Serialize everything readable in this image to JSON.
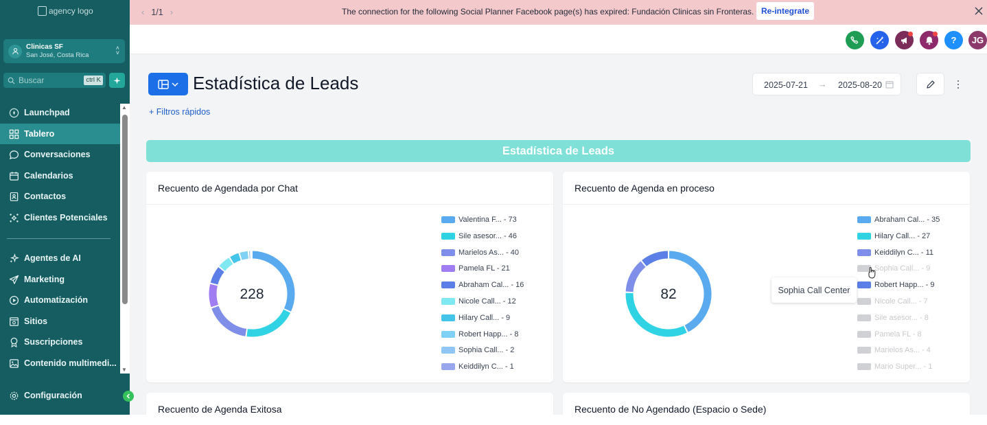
{
  "sidebar": {
    "logo_alt": "agency logo",
    "account": {
      "name": "Clinicas SF",
      "location": "San José, Costa Rica"
    },
    "search": {
      "placeholder": "Buscar",
      "shortcut": "ctrl K"
    },
    "items": [
      {
        "label": "Launchpad",
        "icon": "rocket-icon",
        "active": false
      },
      {
        "label": "Tablero",
        "icon": "grid-icon",
        "active": true
      },
      {
        "label": "Conversaciones",
        "icon": "chat-icon",
        "active": false
      },
      {
        "label": "Calendarios",
        "icon": "calendar-icon",
        "active": false
      },
      {
        "label": "Contactos",
        "icon": "contacts-icon",
        "active": false
      },
      {
        "label": "Clientes Potenciales",
        "icon": "leads-icon",
        "active": false
      },
      {
        "label": "Agentes de AI",
        "icon": "sparkle-icon",
        "active": false
      },
      {
        "label": "Marketing",
        "icon": "send-icon",
        "active": false
      },
      {
        "label": "Automatización",
        "icon": "automation-icon",
        "active": false
      },
      {
        "label": "Sitios",
        "icon": "sites-icon",
        "active": false
      },
      {
        "label": "Suscripciones",
        "icon": "badge-icon",
        "active": false
      },
      {
        "label": "Contenido multimedi...",
        "icon": "image-icon",
        "active": false
      }
    ],
    "settings_label": "Configuración"
  },
  "banner": {
    "pager": "1/1",
    "message": "The connection for the following Social Planner Facebook page(s) has expired: Fundación Clinicas sin Fronteras.",
    "action": "Re-integrate"
  },
  "header": {
    "icons": [
      "phone-icon",
      "magic-icon",
      "megaphone-icon",
      "bell-icon",
      "help-icon"
    ],
    "avatar_initials": "JG",
    "colors": {
      "phone": "#1f9d55",
      "magic": "#2563eb",
      "megaphone": "#7c2d5a",
      "bell": "#8e2a6b",
      "help": "#1e90ff",
      "avatar": "#8b3a6b"
    }
  },
  "main": {
    "title": "Estadística de Leads",
    "quick_filters": "Filtros rápidos",
    "date_from": "2025-07-21",
    "date_to": "2025-08-20",
    "section_title": "Estadística de Leads",
    "tooltip": "Sophia Call Center",
    "cards": [
      {
        "title": "Recuento de Agendada por Chat"
      },
      {
        "title": "Recuento de Agenda en proceso"
      },
      {
        "title": "Recuento de Agenda Exitosa"
      },
      {
        "title": "Recuento de No Agendado (Espacio o Sede)"
      }
    ]
  },
  "chart_data": [
    {
      "type": "pie",
      "title": "Recuento de Agendada por Chat",
      "total": "228",
      "series": [
        {
          "name": "Valentina F...",
          "label": "Valentina F... - 73",
          "value": 73,
          "color": "#5aaaf0",
          "visible": true
        },
        {
          "name": "Sile asesor...",
          "label": "Sile asesor... - 46",
          "value": 46,
          "color": "#2fd3e3",
          "visible": true
        },
        {
          "name": "Marielos As...",
          "label": "Marielos As... - 40",
          "value": 40,
          "color": "#7f8ee8",
          "visible": true
        },
        {
          "name": "Pamela FL",
          "label": "Pamela FL - 21",
          "value": 21,
          "color": "#a07df0",
          "visible": true
        },
        {
          "name": "Abraham Cal...",
          "label": "Abraham Cal... - 16",
          "value": 16,
          "color": "#5b7fe6",
          "visible": true
        },
        {
          "name": "Nicole Call...",
          "label": "Nicole Call... - 12",
          "value": 12,
          "color": "#7fe8f0",
          "visible": true
        },
        {
          "name": "Hilary Call...",
          "label": "Hilary Call... - 9",
          "value": 9,
          "color": "#45c4ea",
          "visible": true
        },
        {
          "name": "Robert Happ...",
          "label": "Robert Happ... - 8",
          "value": 8,
          "color": "#7fd2f5",
          "visible": true
        },
        {
          "name": "Sophia Call...",
          "label": "Sophia Call... - 2",
          "value": 2,
          "color": "#8fc6f5",
          "visible": true
        },
        {
          "name": "Keiddilyn C...",
          "label": "Keiddilyn C... - 1",
          "value": 1,
          "color": "#98a6ee",
          "visible": true
        }
      ]
    },
    {
      "type": "pie",
      "title": "Recuento de Agenda en proceso",
      "total": "82",
      "series": [
        {
          "name": "Abraham Cal...",
          "label": "Abraham Cal... - 35",
          "value": 35,
          "color": "#5aaaf0",
          "visible": true
        },
        {
          "name": "Hilary Call...",
          "label": "Hilary Call... - 27",
          "value": 27,
          "color": "#2fd3e3",
          "visible": true
        },
        {
          "name": "Keiddilyn C...",
          "label": "Keiddilyn C... - 11",
          "value": 11,
          "color": "#7f8ee8",
          "visible": true
        },
        {
          "name": "Sophia Call...",
          "label": "Sophia Call... - 9",
          "value": 9,
          "color": "#cfd1d4",
          "visible": false
        },
        {
          "name": "Robert Happ...",
          "label": "Robert Happ... - 9",
          "value": 9,
          "color": "#5b7fe6",
          "visible": true
        },
        {
          "name": "Nicole Call...",
          "label": "Nicole Call... - 7",
          "value": 7,
          "color": "#cfd1d4",
          "visible": false
        },
        {
          "name": "Sile asesor...",
          "label": "Sile asesor... - 8",
          "value": 8,
          "color": "#cfd1d4",
          "visible": false
        },
        {
          "name": "Pamela FL",
          "label": "Pamela FL - 8",
          "value": 8,
          "color": "#cfd1d4",
          "visible": false
        },
        {
          "name": "Marielos As...",
          "label": "Marielos As... - 4",
          "value": 4,
          "color": "#cfd1d4",
          "visible": false
        },
        {
          "name": "Mario Super...",
          "label": "Mario Super... - 1",
          "value": 1,
          "color": "#cfd1d4",
          "visible": false
        }
      ]
    }
  ]
}
